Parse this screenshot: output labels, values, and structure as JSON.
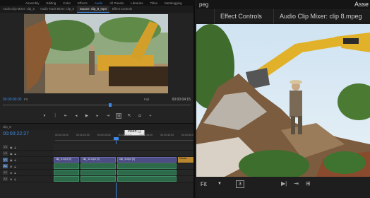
{
  "workspace_menu": [
    "Assembly",
    "Editing",
    "Color",
    "Effects",
    "Audio",
    "All Panels",
    "Libraries",
    "Titles",
    "Metalogging"
  ],
  "workspace_active": "Audio",
  "left_tabs": [
    "Audio Clip Mixer: clip_5",
    "Audio Track Mixer: clip_5",
    "Source: clip_8_mp4",
    "Effect Controls"
  ],
  "left_active_tab": "Source: clip_8_mp4",
  "source_monitor": {
    "timecode_in": "00:00:00:00",
    "timecode_out": "00:00:04:15",
    "zoom": "Fit",
    "resolution": "Full"
  },
  "tooltip": "Insert (,)",
  "transport_icons": [
    "mark-in",
    "mark-out",
    "step-back",
    "play",
    "step-forward",
    "insert",
    "overwrite",
    "export-frame"
  ],
  "timeline": {
    "sequence_name": "clip_5",
    "timecode": "00:00:22:27",
    "ruler_ticks": [
      "00:00:15:00",
      "00:00:20:00",
      "00:00:25:00",
      "00:00:30:00",
      "00:00:35:00",
      "00:00:40:00",
      "00:00:45:00"
    ],
    "tracks": [
      {
        "name": "V3",
        "type": "video"
      },
      {
        "name": "V2",
        "type": "video"
      },
      {
        "name": "V1",
        "type": "video",
        "clips": [
          "clip_6.mp4 [V]",
          "clip_12.mp4 [V]",
          "clip_4.mp4 [V]"
        ],
        "fx": "Mastia"
      },
      {
        "name": "A1",
        "type": "audio"
      },
      {
        "name": "A2",
        "type": "audio"
      },
      {
        "name": "A3",
        "type": "audio"
      }
    ]
  },
  "right_panel": {
    "top_left_title": "peg",
    "brand": "Asse",
    "tabs": [
      "",
      "Effect Controls",
      "Audio Clip Mixer: clip 8.mpeg"
    ],
    "zoom": "Fit",
    "page_number": "3"
  }
}
